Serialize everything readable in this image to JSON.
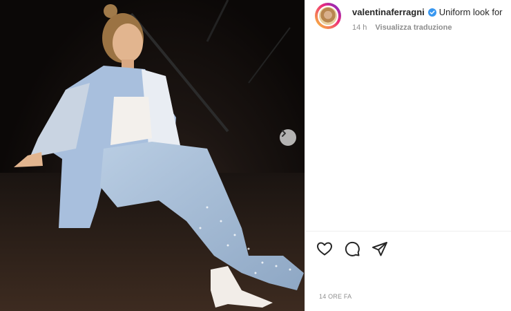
{
  "post": {
    "username": "valentinaferragni",
    "caption": "Uniform look for",
    "time_short": "14 h",
    "translate_label": "Visualizza traduzione",
    "time_full": "14 ORE FA"
  },
  "icons": {
    "verified": "verified-badge-icon",
    "next": "chevron-right-icon",
    "like": "heart-icon",
    "comment": "comment-icon",
    "share": "paper-plane-icon"
  },
  "colors": {
    "verified": "#3897f0",
    "text": "#262626",
    "muted": "#8e8e8e"
  }
}
